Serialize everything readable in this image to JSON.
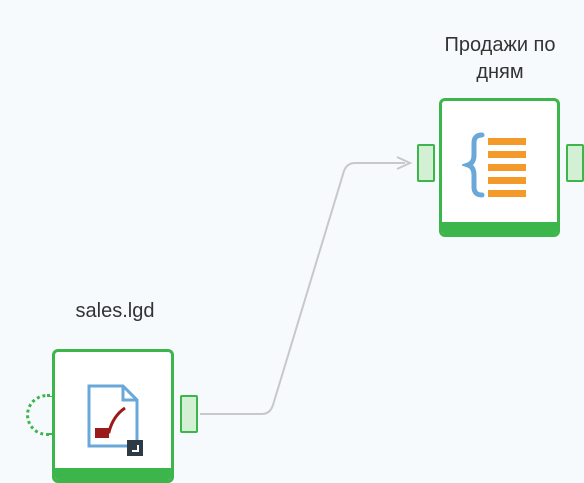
{
  "nodes": {
    "reader": {
      "title": "sales.lgd",
      "icon": "file-reader-icon",
      "status_color": "#3cb54a"
    },
    "aggregate": {
      "title_line1": "Продажи по",
      "title_line2": "дням",
      "icon": "aggregate-list-icon",
      "status_color": "#3cb54a"
    }
  },
  "colors": {
    "canvas_bg": "#f6fafc",
    "node_border": "#3cb54a",
    "port_fill": "#d4f0d4",
    "link": "#c8c8c8",
    "icon_orange": "#f39a2b",
    "icon_blue": "#69a8d8",
    "icon_darkred": "#9b1b1b"
  }
}
